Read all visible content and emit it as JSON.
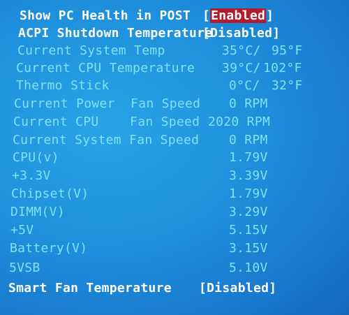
{
  "settings": {
    "show_pc_health": {
      "label": "Show PC Health in POST",
      "value": "Enabled"
    },
    "acpi_shutdown": {
      "label": "ACPI Shutdown Temperature",
      "value": "Disabled"
    },
    "smart_fan": {
      "label": "Smart Fan Temperature",
      "value": "Disabled"
    }
  },
  "temperatures": [
    {
      "label": "Current System Temp",
      "celsius": "35°C/",
      "fahrenheit": "95°F"
    },
    {
      "label": "Current CPU Temperature",
      "celsius": "39°C/",
      "fahrenheit": "102°F"
    },
    {
      "label": "Thermo Stick",
      "celsius": "0°C/",
      "fahrenheit": "32°F"
    }
  ],
  "fans": [
    {
      "label": "Current Power  Fan Speed",
      "value": "0 RPM"
    },
    {
      "label": "Current CPU    Fan Speed",
      "value": "2020 RPM"
    },
    {
      "label": "Current System Fan Speed",
      "value": "0 RPM"
    }
  ],
  "voltages": [
    {
      "label": "CPU(v)",
      "value": "1.79V"
    },
    {
      "label": "+3.3V",
      "value": "3.39V"
    },
    {
      "label": "Chipset(V)",
      "value": "1.79V"
    },
    {
      "label": "DIMM(V)",
      "value": "3.29V"
    },
    {
      "label": "+5V",
      "value": "5.15V"
    },
    {
      "label": "Battery(V)",
      "value": "3.15V"
    },
    {
      "label": "5VSB",
      "value": "5.10V"
    }
  ],
  "colors": {
    "background": "#1e8fdc",
    "label_dim": "#7fe3f5",
    "label_bright": "#ffffff",
    "selection": "#b31c2e"
  }
}
